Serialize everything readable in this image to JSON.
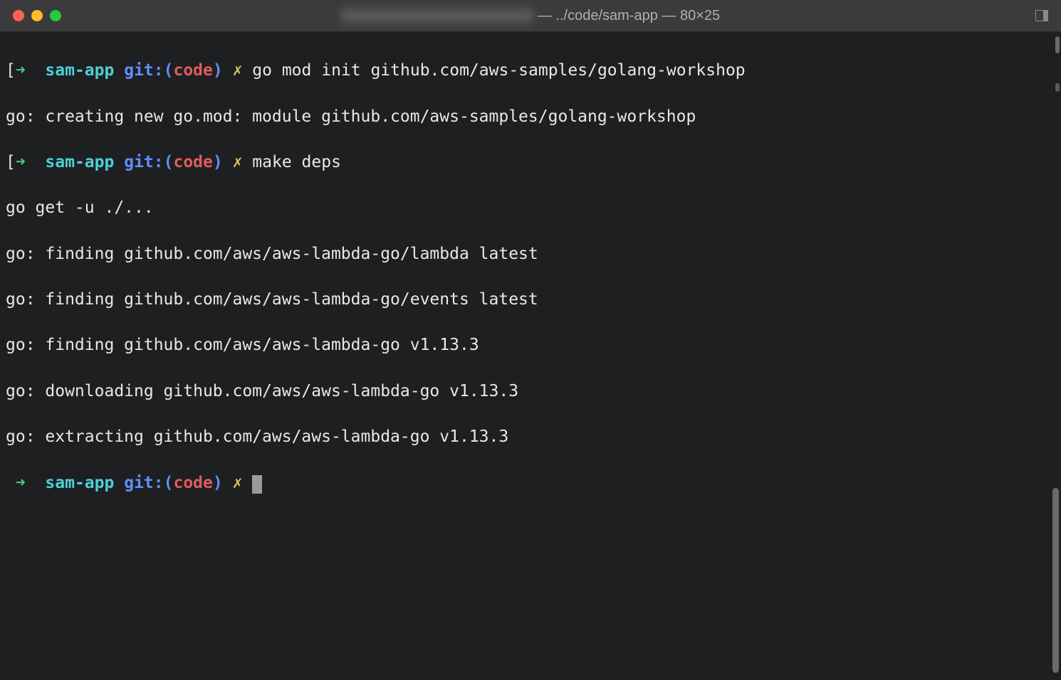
{
  "window": {
    "title_path": " — ../code/sam-app — 80×25"
  },
  "prompt": {
    "bracket_open": "[",
    "bracket_close": "]",
    "arrow": "➜",
    "dir": "sam-app",
    "git_label": "git:(",
    "branch": "code",
    "git_close": ")",
    "dirty": "✗"
  },
  "lines": {
    "cmd1": "go mod init github.com/aws-samples/golang-workshop",
    "out1": "go: creating new go.mod: module github.com/aws-samples/golang-workshop",
    "cmd2": "make deps",
    "out2": "go get -u ./...",
    "out3": "go: finding github.com/aws/aws-lambda-go/lambda latest",
    "out4": "go: finding github.com/aws/aws-lambda-go/events latest",
    "out5": "go: finding github.com/aws/aws-lambda-go v1.13.3",
    "out6": "go: downloading github.com/aws/aws-lambda-go v1.13.3",
    "out7": "go: extracting github.com/aws/aws-lambda-go v1.13.3"
  }
}
